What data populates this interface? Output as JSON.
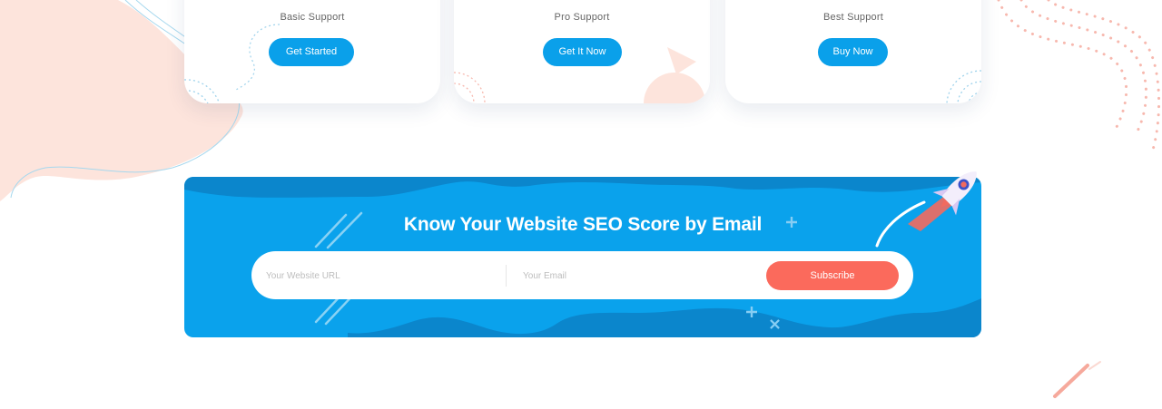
{
  "cards": [
    {
      "label": "Basic Support",
      "button": "Get Started"
    },
    {
      "label": "Pro Support",
      "button": "Get It Now"
    },
    {
      "label": "Best Support",
      "button": "Buy Now"
    }
  ],
  "seo": {
    "title": "Know Your Website SEO Score by Email",
    "url_placeholder": "Your Website URL",
    "email_placeholder": "Your Email",
    "subscribe_label": "Subscribe"
  },
  "colors": {
    "primary": "#0aa0ea",
    "banner": "#0aa2ec",
    "banner_wave": "#0b86cc",
    "accent": "#fb6a5c",
    "blob": "#fde4dc"
  },
  "icons": [
    "rocket-icon",
    "plus-icon",
    "cross-icon",
    "streak-icon",
    "dots-decoration"
  ]
}
